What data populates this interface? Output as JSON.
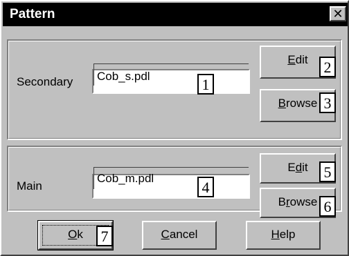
{
  "window": {
    "title": "Pattern",
    "close_glyph": "✕"
  },
  "secondary": {
    "label": "Secondary",
    "value": "Cob_s.pdl",
    "edit_label_pre": "",
    "edit_label_accel": "E",
    "edit_label_post": "dit",
    "browse_label_pre": "",
    "browse_label_accel": "B",
    "browse_label_post": "rowse"
  },
  "main": {
    "label": "Main",
    "value": "Cob_m.pdl",
    "edit_label_pre": "E",
    "edit_label_accel": "d",
    "edit_label_post": "it",
    "browse_label_pre": "B",
    "browse_label_accel": "r",
    "browse_label_post": "owse"
  },
  "footer": {
    "ok_accel": "O",
    "ok_post": "k",
    "cancel_accel": "C",
    "cancel_post": "ancel",
    "help_accel": "H",
    "help_post": "elp"
  },
  "callouts": [
    "1",
    "2",
    "3",
    "4",
    "5",
    "6",
    "7"
  ]
}
